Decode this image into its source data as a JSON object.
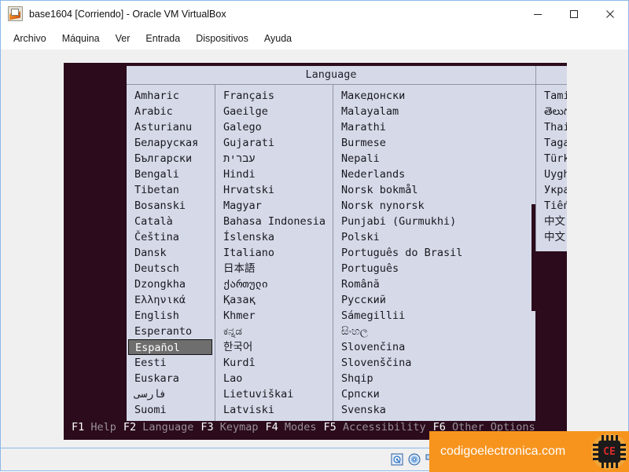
{
  "window": {
    "title": "base1604 [Corriendo] - Oracle VM VirtualBox",
    "icon": "virtualbox-icon",
    "controls": {
      "minimize": "minimize-button",
      "maximize": "maximize-button",
      "close": "close-button"
    }
  },
  "menubar": {
    "items": [
      {
        "label": "Archivo"
      },
      {
        "label": "Máquina"
      },
      {
        "label": "Ver"
      },
      {
        "label": "Entrada"
      },
      {
        "label": "Dispositivos"
      },
      {
        "label": "Ayuda"
      }
    ]
  },
  "installer": {
    "panel_title": "Language",
    "selected_language": "Español",
    "columns": [
      {
        "name": "column-1",
        "items": [
          "Amharic",
          "Arabic",
          "Asturianu",
          "Беларуская",
          "Български",
          "Bengali",
          "Tibetan",
          "Bosanski",
          "Català",
          "Čeština",
          "Dansk",
          "Deutsch",
          "Dzongkha",
          "Ελληνικά",
          "English",
          "Esperanto",
          "Español",
          "Eesti",
          "Euskara",
          "فارسی",
          "Suomi"
        ]
      },
      {
        "name": "column-2",
        "items": [
          "Français",
          "Gaeilge",
          "Galego",
          "Gujarati",
          "עברית",
          "Hindi",
          "Hrvatski",
          "Magyar",
          "Bahasa Indonesia",
          "Íslenska",
          "Italiano",
          "日本語",
          "ქართული",
          "Қазақ",
          "Khmer",
          "ಕನ್ನಡ",
          "한국어",
          "Kurdî",
          "Lao",
          "Lietuviškai",
          "Latviski"
        ]
      },
      {
        "name": "column-3",
        "items": [
          "Македонски",
          "Malayalam",
          "Marathi",
          "Burmese",
          "Nepali",
          "Nederlands",
          "Norsk bokmål",
          "Norsk nynorsk",
          "Punjabi (Gurmukhi)",
          "Polski",
          "Português do Brasil",
          "Português",
          "Română",
          "Русский",
          "Sámegillii",
          "සිංහල",
          "Slovenčina",
          "Slovenščina",
          "Shqip",
          "Српски",
          "Svenska"
        ]
      },
      {
        "name": "column-4",
        "items": [
          "Tamil",
          "తెలుగు",
          "Thai",
          "Tagalog",
          "Türkçe",
          "Uyghur",
          "Українська",
          "Tiếng Việt",
          "中文(简体)",
          "中文(繁體)"
        ]
      }
    ],
    "function_keys": [
      {
        "key": "F1",
        "label": "Help"
      },
      {
        "key": "F2",
        "label": "Language"
      },
      {
        "key": "F3",
        "label": "Keymap"
      },
      {
        "key": "F4",
        "label": "Modes"
      },
      {
        "key": "F5",
        "label": "Accessibility"
      },
      {
        "key": "F6",
        "label": "Other Options"
      }
    ]
  },
  "watermark": {
    "text": "codigoelectronica.com",
    "logo_text": "CE",
    "background_color": "#f7941e"
  },
  "statusbar": {
    "icons": [
      "hard-disk-icon",
      "optical-disc-icon",
      "network-icon"
    ]
  },
  "colors": {
    "vm_background": "#2b0b1c",
    "panel_background": "#d6dae8",
    "selection_background": "#6e6e6e",
    "accent": "#f7941e"
  }
}
